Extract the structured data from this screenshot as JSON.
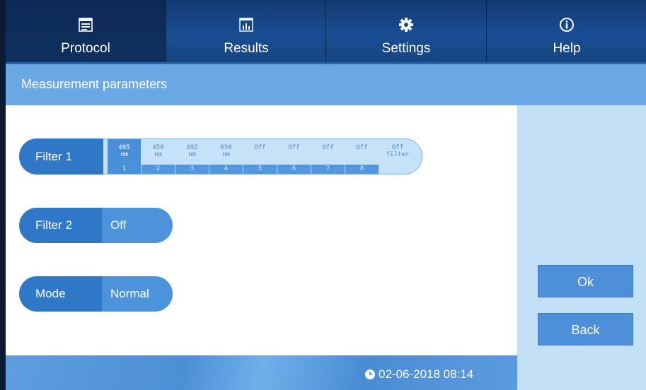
{
  "tabs": [
    {
      "label": "Protocol",
      "icon": "window-icon",
      "active": true
    },
    {
      "label": "Results",
      "icon": "bar-chart-icon",
      "active": false
    },
    {
      "label": "Settings",
      "icon": "gear-icon",
      "active": false
    },
    {
      "label": "Help",
      "icon": "info-icon",
      "active": false
    }
  ],
  "page": {
    "title": "Measurement parameters"
  },
  "filter1": {
    "label": "Filter 1",
    "options": [
      {
        "line1": "405",
        "line2": "nm",
        "num": "1",
        "selected": true
      },
      {
        "line1": "450",
        "line2": "nm",
        "num": "2",
        "selected": false
      },
      {
        "line1": "492",
        "line2": "nm",
        "num": "3",
        "selected": false
      },
      {
        "line1": "630",
        "line2": "nm",
        "num": "4",
        "selected": false
      },
      {
        "line1": "Off",
        "line2": "",
        "num": "5",
        "selected": false
      },
      {
        "line1": "Off",
        "line2": "",
        "num": "6",
        "selected": false
      },
      {
        "line1": "Off",
        "line2": "",
        "num": "7",
        "selected": false
      },
      {
        "line1": "Off",
        "line2": "",
        "num": "8",
        "selected": false
      },
      {
        "line1": "Off",
        "line2": "filter",
        "num": "",
        "selected": false
      }
    ]
  },
  "filter2": {
    "label": "Filter 2",
    "value": "Off"
  },
  "mode": {
    "label": "Mode",
    "value": "Normal"
  },
  "buttons": {
    "ok": "Ok",
    "back": "Back"
  },
  "status": {
    "datetime": "02-06-2018 08:14"
  },
  "colors": {
    "accent": "#2f78c8",
    "topbar": "#1a4d93",
    "titlebar": "#6aa8e5",
    "sidepanel": "#c3e0f7"
  }
}
